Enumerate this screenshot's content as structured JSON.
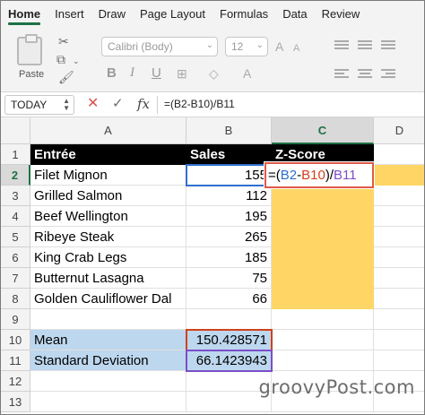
{
  "ribbon": {
    "tabs": [
      "Home",
      "Insert",
      "Draw",
      "Page Layout",
      "Formulas",
      "Data",
      "Review"
    ],
    "active_tab": "Home",
    "paste_label": "Paste",
    "font_name": "Calibri (Body)",
    "font_size": "12",
    "bold": "B",
    "italic": "I",
    "underline": "U"
  },
  "formula_bar": {
    "name_box": "TODAY",
    "fx": "fx",
    "formula": "=(B2-B10)/B11"
  },
  "sheet": {
    "columns": [
      "A",
      "B",
      "C",
      "D"
    ],
    "rows": [
      "1",
      "2",
      "3",
      "4",
      "5",
      "6",
      "7",
      "8",
      "9",
      "10",
      "11",
      "12",
      "13"
    ],
    "headers": {
      "entree": "Entrée",
      "sales": "Sales",
      "zscore": "Z-Score"
    },
    "items": [
      {
        "name": "Filet Mignon",
        "sales": "155"
      },
      {
        "name": "Grilled Salmon",
        "sales": "112"
      },
      {
        "name": "Beef Wellington",
        "sales": "195"
      },
      {
        "name": "Ribeye Steak",
        "sales": "265"
      },
      {
        "name": "King Crab Legs",
        "sales": "185"
      },
      {
        "name": "Butternut Lasagna",
        "sales": "75"
      },
      {
        "name": "Golden Cauliflower Dal",
        "sales": "66"
      }
    ],
    "mean_label": "Mean",
    "mean_value": "150.428571",
    "sd_label": "Standard Deviation",
    "sd_value": "66.1423943",
    "active_cell": {
      "open": "=(",
      "ref1": "B2",
      "minus": "-",
      "ref2": "B10",
      "close": ")/",
      "ref3": "B11"
    }
  },
  "watermark": "groovyPost.com",
  "colors": {
    "accent": "#1e7145",
    "highlight_yellow": "#ffd666",
    "highlight_blue": "#bdd7ee",
    "ref_blue": "#2f6fcf",
    "ref_red": "#d0421b",
    "ref_purple": "#7b4fc9"
  }
}
